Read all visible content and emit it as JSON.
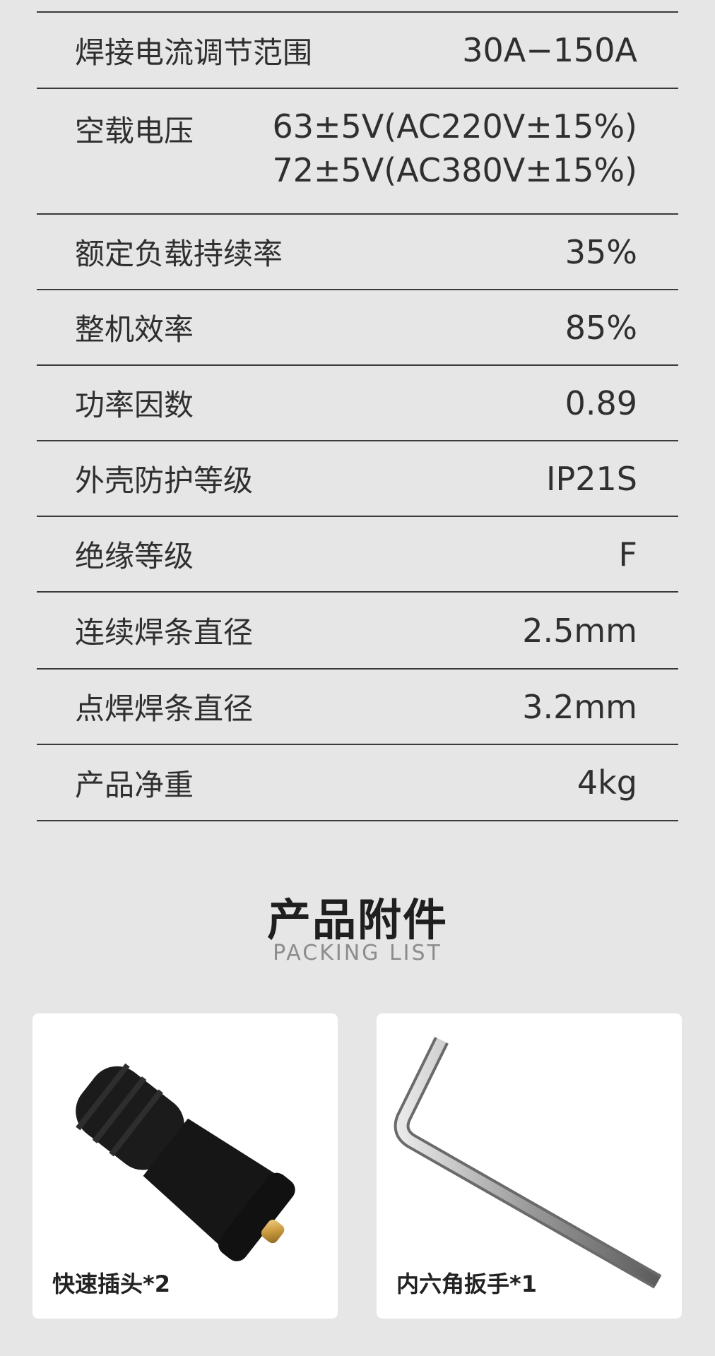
{
  "specs": [
    {
      "label": "焊接电流调节范围",
      "value": "30A−150A"
    },
    {
      "label": "空载电压",
      "value_lines": [
        "63±5V(AC220V±15%)",
        "72±5V(AC380V±15%)"
      ]
    },
    {
      "label": "额定负载持续率",
      "value": "35%"
    },
    {
      "label": "整机效率",
      "value": "85%"
    },
    {
      "label": "功率因数",
      "value": "0.89"
    },
    {
      "label": "外壳防护等级",
      "value": "IP21S"
    },
    {
      "label": "绝缘等级",
      "value": "F"
    },
    {
      "label": "连续焊条直径",
      "value": "2.5mm"
    },
    {
      "label": "点焊焊条直径",
      "value": "3.2mm"
    },
    {
      "label": "产品净重",
      "value": "4kg"
    }
  ],
  "accessories": {
    "title": "产品附件",
    "subtitle": "PACKING LIST",
    "items": [
      {
        "label": "快速插头*2",
        "icon": "cable-connector-icon"
      },
      {
        "label": "内六角扳手*1",
        "icon": "hex-key-wrench-icon"
      }
    ]
  },
  "colors": {
    "background": "#e6e6e6",
    "divider": "#3a3a3a",
    "card": "#ffffff"
  }
}
